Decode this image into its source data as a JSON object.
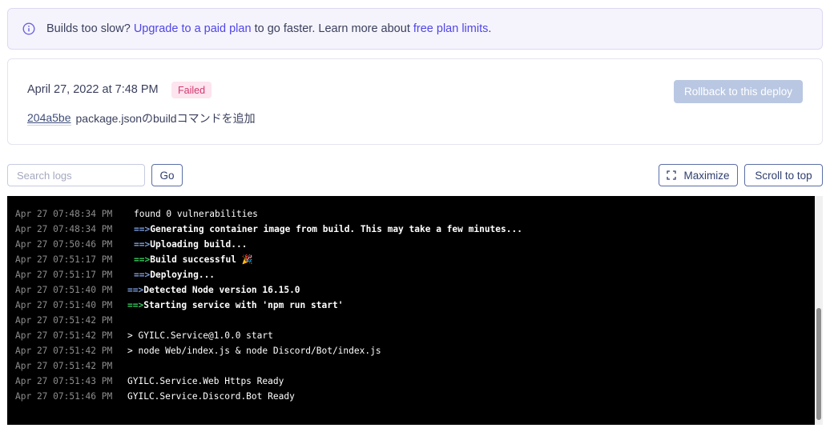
{
  "banner": {
    "prefix": "Builds too slow?",
    "upgrade_link": "Upgrade to a paid plan",
    "middle": "to go faster. Learn more about",
    "limits_link": "free plan limits",
    "suffix": ".",
    "icon": "info-circle-icon"
  },
  "deploy": {
    "date": "April 27, 2022 at 7:48 PM",
    "status": "Failed",
    "rollback_label": "Rollback to this deploy",
    "commit_hash": "204a5be",
    "commit_message": "package.jsonのbuildコマンドを追加"
  },
  "toolbar": {
    "search_placeholder": "Search logs",
    "search_value": "",
    "go_label": "Go",
    "maximize_label": "Maximize",
    "scroll_top_label": "Scroll to top"
  },
  "logs": [
    {
      "ts": "Apr 27 07:48:34 PM",
      "arrow": "",
      "indent": true,
      "msg": "found 0 vulnerabilities",
      "bold": false
    },
    {
      "ts": "Apr 27 07:48:34 PM",
      "arrow": "blue",
      "indent": true,
      "msg": "Generating container image from build. This may take a few minutes...",
      "bold": true
    },
    {
      "ts": "Apr 27 07:50:46 PM",
      "arrow": "blue",
      "indent": true,
      "msg": "Uploading build...",
      "bold": true
    },
    {
      "ts": "Apr 27 07:51:17 PM",
      "arrow": "green",
      "indent": true,
      "msg": "Build successful 🎉",
      "bold": true
    },
    {
      "ts": "Apr 27 07:51:17 PM",
      "arrow": "blue",
      "indent": true,
      "msg": "Deploying...",
      "bold": true
    },
    {
      "ts": "Apr 27 07:51:40 PM",
      "arrow": "blue",
      "indent": false,
      "msg": "Detected Node version 16.15.0",
      "bold": true
    },
    {
      "ts": "Apr 27 07:51:40 PM",
      "arrow": "green",
      "indent": false,
      "msg": "Starting service with 'npm run start'",
      "bold": true
    },
    {
      "ts": "Apr 27 07:51:42 PM",
      "arrow": "",
      "indent": false,
      "msg": "",
      "bold": false
    },
    {
      "ts": "Apr 27 07:51:42 PM",
      "arrow": "",
      "indent": false,
      "msg": "> GYILC.Service@1.0.0 start",
      "bold": false
    },
    {
      "ts": "Apr 27 07:51:42 PM",
      "arrow": "",
      "indent": false,
      "msg": "> node Web/index.js & node Discord/Bot/index.js",
      "bold": false
    },
    {
      "ts": "Apr 27 07:51:42 PM",
      "arrow": "",
      "indent": false,
      "msg": "",
      "bold": false
    },
    {
      "ts": "Apr 27 07:51:43 PM",
      "arrow": "",
      "indent": false,
      "msg": "GYILC.Service.Web Https Ready",
      "bold": false
    },
    {
      "ts": "Apr 27 07:51:46 PM",
      "arrow": "",
      "indent": false,
      "msg": "GYILC.Service.Discord.Bot Ready",
      "bold": false
    }
  ],
  "arrow_text": "==>",
  "colors": {
    "accent_link": "#5046e5",
    "failed_badge_bg": "#fde4ee",
    "failed_badge_text": "#d2386f",
    "arrow_blue": "#7d9ee0",
    "arrow_green": "#36c95f",
    "log_bg": "#000000"
  }
}
